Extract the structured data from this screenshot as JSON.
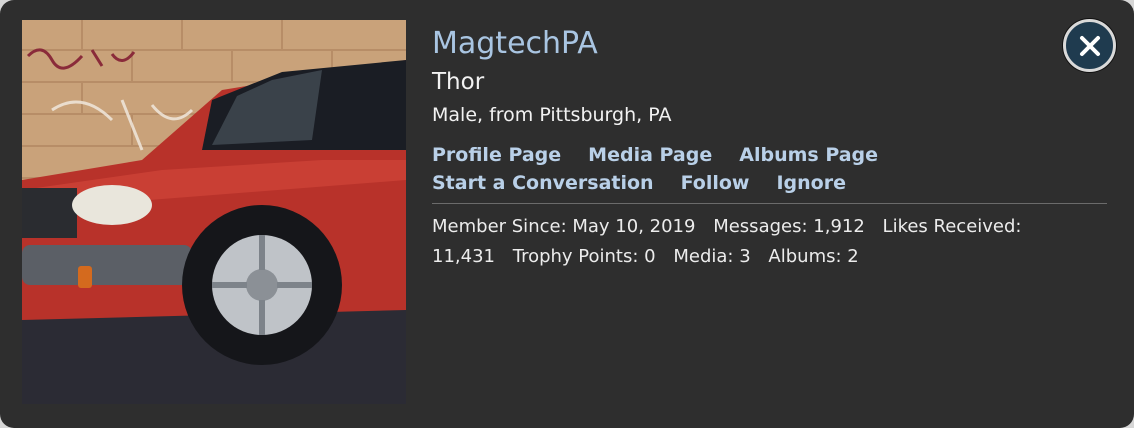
{
  "profile": {
    "username": "MagtechPA",
    "custom_title": "Thor",
    "blurb": "Male, from Pittsburgh, PA"
  },
  "links": [
    {
      "label": "Profile Page"
    },
    {
      "label": "Media Page"
    },
    {
      "label": "Albums Page"
    },
    {
      "label": "Start a Conversation"
    },
    {
      "label": "Follow"
    },
    {
      "label": "Ignore"
    }
  ],
  "stats": {
    "member_since_label": "Member Since:",
    "member_since_value": "May 10, 2019",
    "messages_label": "Messages:",
    "messages_value": "1,912",
    "likes_label": "Likes Received:",
    "likes_value": "11,431",
    "trophy_label": "Trophy Points:",
    "trophy_value": "0",
    "media_label": "Media:",
    "media_value": "3",
    "albums_label": "Albums:",
    "albums_value": "2"
  },
  "icons": {
    "close": "close-icon",
    "avatar": "avatar-photo"
  },
  "colors": {
    "panel_bg": "#2e2e2e",
    "username": "#a9c5e2",
    "link": "#b9d0e8",
    "close_bg": "#1f3b4f"
  }
}
